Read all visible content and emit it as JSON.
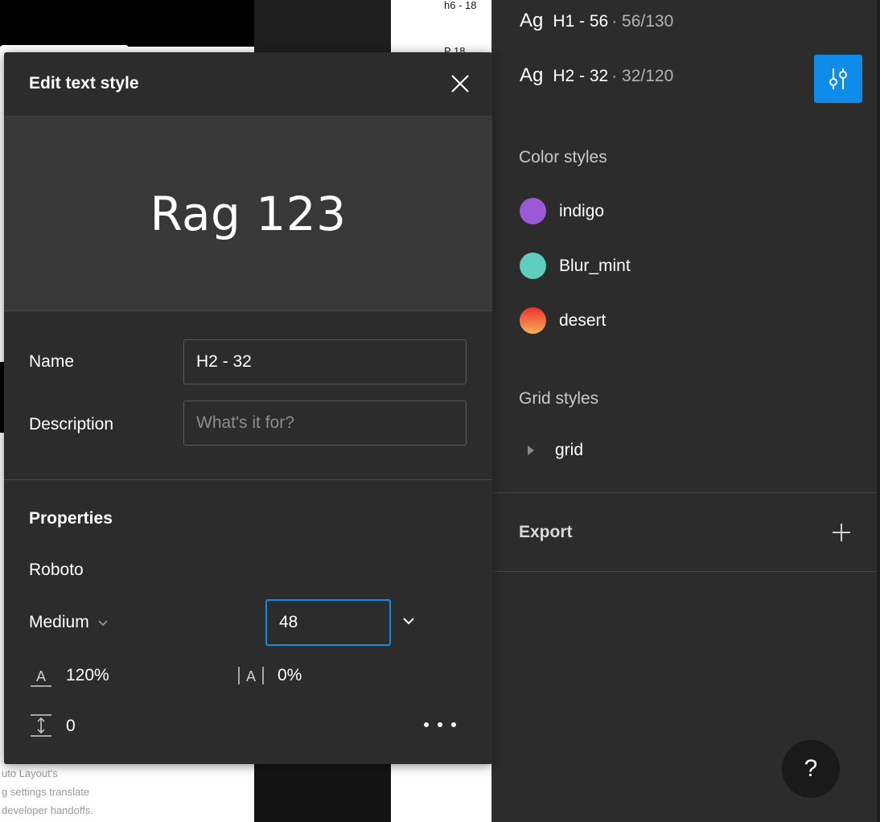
{
  "background": {
    "top_label": "h6 - 18",
    "second_label": "P 18",
    "faded_lines": [
      "uto Layout's",
      "g settings translate",
      "developer handoffs."
    ]
  },
  "modal": {
    "title": "Edit text style",
    "preview_text": "Rag 123",
    "name_label": "Name",
    "name_value": "H2 - 32",
    "description_label": "Description",
    "description_placeholder": "What's it for?",
    "properties_title": "Properties",
    "font_family": "Roboto",
    "font_weight": "Medium",
    "font_size": "48",
    "line_height": "120%",
    "letter_spacing": "0%",
    "paragraph_spacing": "0"
  },
  "panel": {
    "text_styles": [
      {
        "sample": "Ag",
        "name": "H1 - 56",
        "meta": "· 56/130"
      },
      {
        "sample": "Ag",
        "name": "H2 - 32",
        "meta": "· 32/120"
      }
    ],
    "color_styles_title": "Color styles",
    "color_styles": [
      {
        "name": "indigo",
        "color": "#9b59d6"
      },
      {
        "name": "Blur_mint",
        "color": "#5fcfbd"
      },
      {
        "name": "desert",
        "gradient": [
          "#ef2e2e",
          "#f5b256"
        ]
      }
    ],
    "grid_styles_title": "Grid styles",
    "grid_styles": [
      {
        "name": "grid"
      }
    ],
    "export_title": "Export",
    "help_label": "?"
  },
  "colors": {
    "accent": "#0d8ce9",
    "panel_bg": "#2c2c2c",
    "preview_bg": "#383838"
  }
}
